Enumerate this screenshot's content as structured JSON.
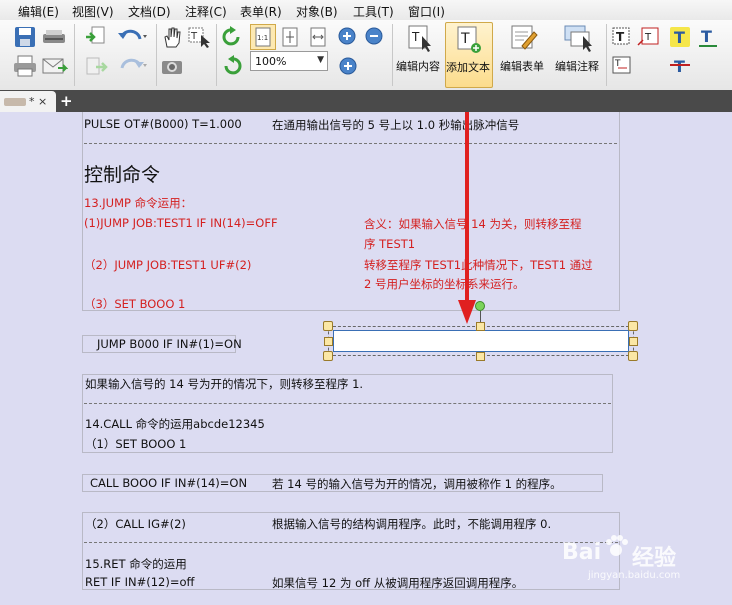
{
  "menu": [
    "编辑(E)",
    "视图(V)",
    "文档(D)",
    "注释(C)",
    "表单(R)",
    "对象(B)",
    "工具(T)",
    "窗口(I)"
  ],
  "toolbar": {
    "zoom_value": "100%",
    "zoom_dropdown_arrow": "▼",
    "edit_content_label": "编辑内容",
    "add_text_label": "添加文本",
    "edit_form_label": "编辑表单",
    "edit_annotation_label": "编辑注释",
    "page_fit_label": "1:1"
  },
  "tab": {
    "title": "* ",
    "close": "×",
    "add": "+"
  },
  "doc": {
    "line1_left": "PULSE OT#(B000) T=1.000",
    "line1_right": "在通用输出信号的 5 号上以 1.0 秒输出脉冲信号",
    "heading": "控制命令",
    "jump_title": "13.JUMP 命令运用：",
    "jump1": "(1)JUMP JOB:TEST1 IF IN(14)=OFF",
    "jump1_desc_a": "含义：如果输入信号  14  为关，则转移至程",
    "jump1_desc_b": "序 TEST1",
    "jump2": "（2）JUMP JOB:TEST1 UF#(2)",
    "jump2_desc_a": "转移至程序 TEST1此种情况下，TEST1 通过",
    "jump2_desc_b": "2 号用户坐标的坐标系来运行。",
    "jump3": "（3）SET BOOO 1",
    "jump_b000": "JUMP B000 IF IN#(1)=ON",
    "jump_b000_desc": "如果输入信号的 14 号为开的情况下，则转移至程序 1.",
    "call_title": "14.CALL 命令的运用abcde12345",
    "call1": "（1）SET BOOO 1",
    "call_b000": "CALL BOOO IF IN#(14)=ON",
    "call_b000_desc": "若 14 号的输入信号为开的情况，调用被称作 1 的程序。",
    "call2": "（2）CALL IG#(2)",
    "call2_desc": "根据输入信号的结构调用程序。此时，不能调用程序 0.",
    "ret_title": "15.RET 命令的运用",
    "ret1": "RET IF IN#(12)=off",
    "ret1_desc": "如果信号 12 为 off  从被调用程序返回调用程序。"
  },
  "watermark": {
    "brand": "Bai",
    "brand2": "经验",
    "sub": "jingyan.baidu.com"
  },
  "colors": {
    "accent_red": "#e02020",
    "selection_blue": "#3a6fb5",
    "page_bg": "#dcdcf2"
  }
}
